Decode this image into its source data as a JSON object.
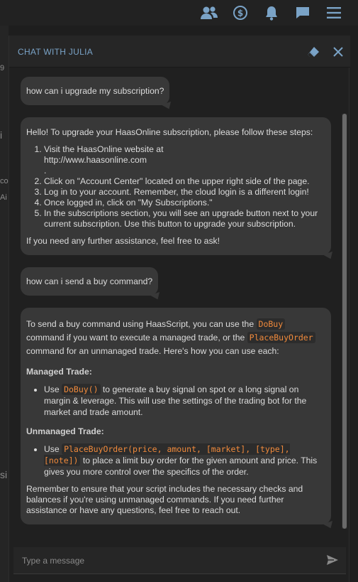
{
  "topbar": {
    "icons": [
      "users-icon",
      "dollar-icon",
      "bell-icon",
      "chat-icon",
      "menu-icon"
    ]
  },
  "left_edge": {
    "fragments": [
      "9",
      "i",
      "co",
      "Ai",
      "si"
    ]
  },
  "chat": {
    "title": "CHAT WITH JULIA",
    "icons": {
      "clear": "eraser-icon",
      "close": "close-icon"
    },
    "messages": [
      {
        "role": "user",
        "text": "how can i upgrade my subscription?"
      },
      {
        "role": "assistant",
        "intro": "Hello! To upgrade your HaasOnline subscription, please follow these steps:",
        "steps": [
          "Visit the HaasOnline website at http://www.haasonline.com\n.",
          "Click on \"Account Center\" located on the upper right side of the page.",
          "Log in to your account. Remember, the cloud login is a different login!",
          "Once logged in, click on \"My Subscriptions.\"",
          "In the subscriptions section, you will see an upgrade button next to your current subscription. Use this button to upgrade your subscription."
        ],
        "outro": "If you need any further assistance, feel free to ask!"
      },
      {
        "role": "user",
        "text": "how can i send a buy command?"
      },
      {
        "role": "assistant",
        "intro_a": "To send a buy command using HaasScript, you can use the ",
        "code_dobuy": "DoBuy",
        "intro_b": " command if you want to execute a managed trade, or the ",
        "code_placebuy": "PlaceBuyOrder",
        "intro_c": " command for an unmanaged trade. Here's how you can use each:",
        "managed_title": "Managed Trade:",
        "managed_a": "Use ",
        "managed_code": "DoBuy()",
        "managed_b": " to generate a buy signal on spot or a long signal on margin & leverage. This will use the settings of the trading bot for the market and trade amount.",
        "unmanaged_title": "Unmanaged Trade:",
        "unmanaged_a": "Use ",
        "unmanaged_code": "PlaceBuyOrder(price, amount, [market], [type], [note])",
        "unmanaged_b": " to place a limit buy order for the given amount and price. This gives you more control over the specifics of the order.",
        "outro": "Remember to ensure that your script includes the necessary checks and balances if you're using unmanaged commands. If you need further assistance or have any questions, feel free to reach out."
      }
    ],
    "input": {
      "placeholder": "Type a message",
      "value": ""
    },
    "send_icon": "send-icon"
  },
  "colors": {
    "accent": "#7aa3c7",
    "bubble": "#383838",
    "code": "#f08a3c",
    "background": "#202020"
  }
}
